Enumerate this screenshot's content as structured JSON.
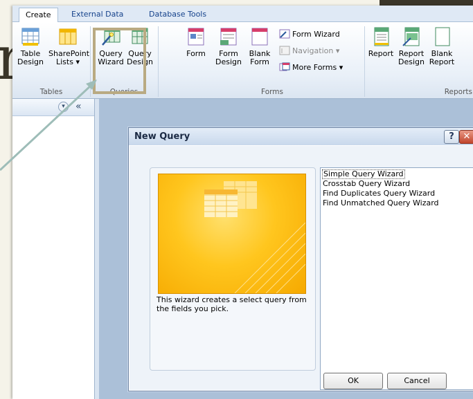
{
  "slide": {
    "glyph": "n"
  },
  "tabs": [
    {
      "label": "Create",
      "active": true
    },
    {
      "label": "External Data"
    },
    {
      "label": "Database Tools"
    }
  ],
  "ribbon": {
    "groups": {
      "tables": "Tables",
      "queries": "Queries",
      "forms": "Forms",
      "reports": "Reports"
    },
    "buttons": {
      "table_design": [
        "Table",
        "Design"
      ],
      "sharepoint_lists": [
        "SharePoint",
        "Lists ▾"
      ],
      "query_wizard": [
        "Query",
        "Wizard"
      ],
      "query_design": [
        "Query",
        "Design"
      ],
      "form": [
        "Form"
      ],
      "form_design": [
        "Form",
        "Design"
      ],
      "blank_form": [
        "Blank",
        "Form"
      ],
      "report": [
        "Report"
      ],
      "report_design": [
        "Report",
        "Design"
      ],
      "blank_report": [
        "Blank",
        "Report"
      ]
    },
    "small_buttons": {
      "form_wizard": "Form Wizard",
      "navigation": "Navigation ▾",
      "more_forms": "More Forms ▾"
    }
  },
  "navpane": {
    "collapse_glyph": "«",
    "dropdown_glyph": "▾"
  },
  "dialog": {
    "title": "New Query",
    "help_glyph": "?",
    "close_glyph": "✕",
    "description": "This wizard creates a select query from the fields you pick.",
    "options": [
      "Simple Query Wizard",
      "Crosstab Query Wizard",
      "Find Duplicates Query Wizard",
      "Find Unmatched Query Wizard"
    ],
    "selected_index": 0,
    "ok_label": "OK",
    "cancel_label": "Cancel"
  },
  "colors": {
    "highlight": "#b9aa82",
    "arrow": "#9ebdb8"
  }
}
